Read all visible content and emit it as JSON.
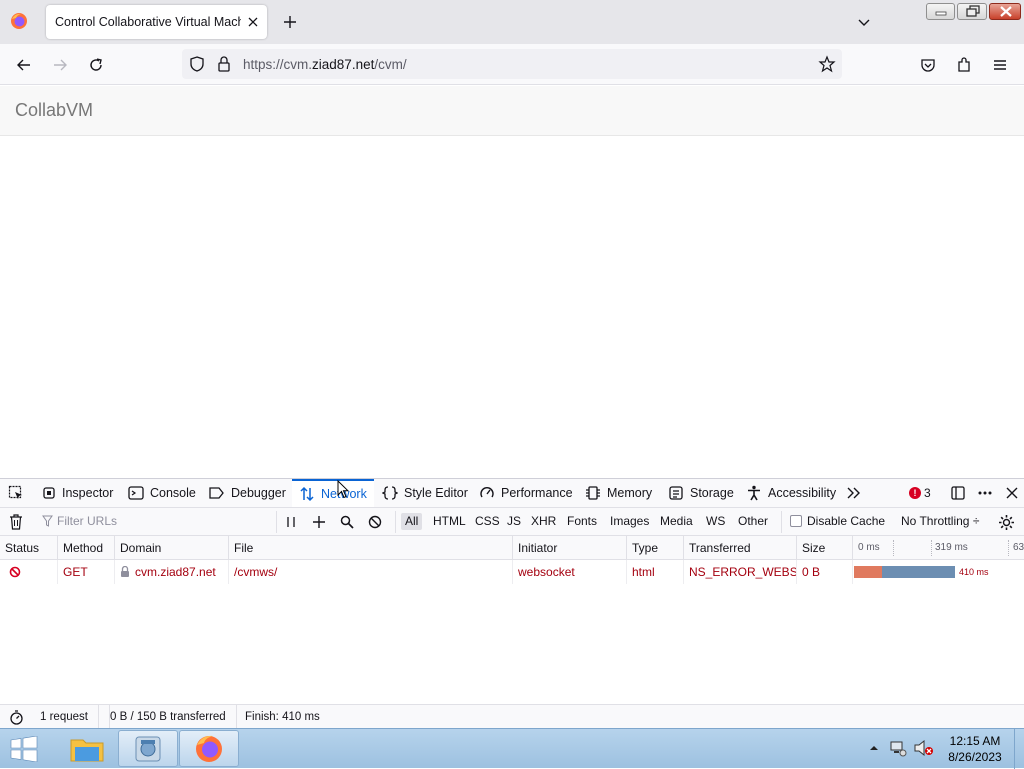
{
  "browser": {
    "tab_title": "Control Collaborative Virtual Machi",
    "url_scheme": "https://cvm.",
    "url_host": "ziad87.net",
    "url_path": "/cvm/"
  },
  "page": {
    "brand": "CollabVM"
  },
  "devtools": {
    "tabs": [
      {
        "label": "Inspector",
        "icon": "inspector-icon"
      },
      {
        "label": "Console",
        "icon": "console-icon"
      },
      {
        "label": "Debugger",
        "icon": "debugger-icon"
      },
      {
        "label": "Network",
        "icon": "network-icon",
        "active": true
      },
      {
        "label": "Style Editor",
        "icon": "style-editor-icon"
      },
      {
        "label": "Performance",
        "icon": "performance-icon"
      },
      {
        "label": "Memory",
        "icon": "memory-icon"
      },
      {
        "label": "Storage",
        "icon": "storage-icon"
      },
      {
        "label": "Accessibility",
        "icon": "accessibility-icon"
      }
    ],
    "error_count": "3",
    "filter_placeholder": "Filter URLs",
    "type_filters": [
      "All",
      "HTML",
      "CSS",
      "JS",
      "XHR",
      "Fonts",
      "Images",
      "Media",
      "WS",
      "Other"
    ],
    "disable_cache_label": "Disable Cache",
    "throttling_label": "No Throttling ÷",
    "columns": [
      "Status",
      "Method",
      "Domain",
      "File",
      "Initiator",
      "Type",
      "Transferred",
      "Size"
    ],
    "timeline_ticks": [
      "0 ms",
      "319 ms",
      "63"
    ],
    "request": {
      "method": "GET",
      "domain": "cvm.ziad87.net",
      "file": "/cvmws/",
      "initiator": "websocket",
      "type": "html",
      "transferred": "NS_ERROR_WEBS...",
      "size": "0 B",
      "timing": "410 ms"
    },
    "status_bar": {
      "requests": "1 request",
      "transferred": "0 B / 150 B transferred",
      "finish": "Finish: 410 ms"
    }
  },
  "taskbar": {
    "time": "12:15 AM",
    "date": "8/26/2023"
  },
  "colors": {
    "accent": "#0a64d4",
    "error": "#a4000f",
    "waterfall_wait": "#e07a5f",
    "waterfall_receive": "#6c8eb2"
  }
}
